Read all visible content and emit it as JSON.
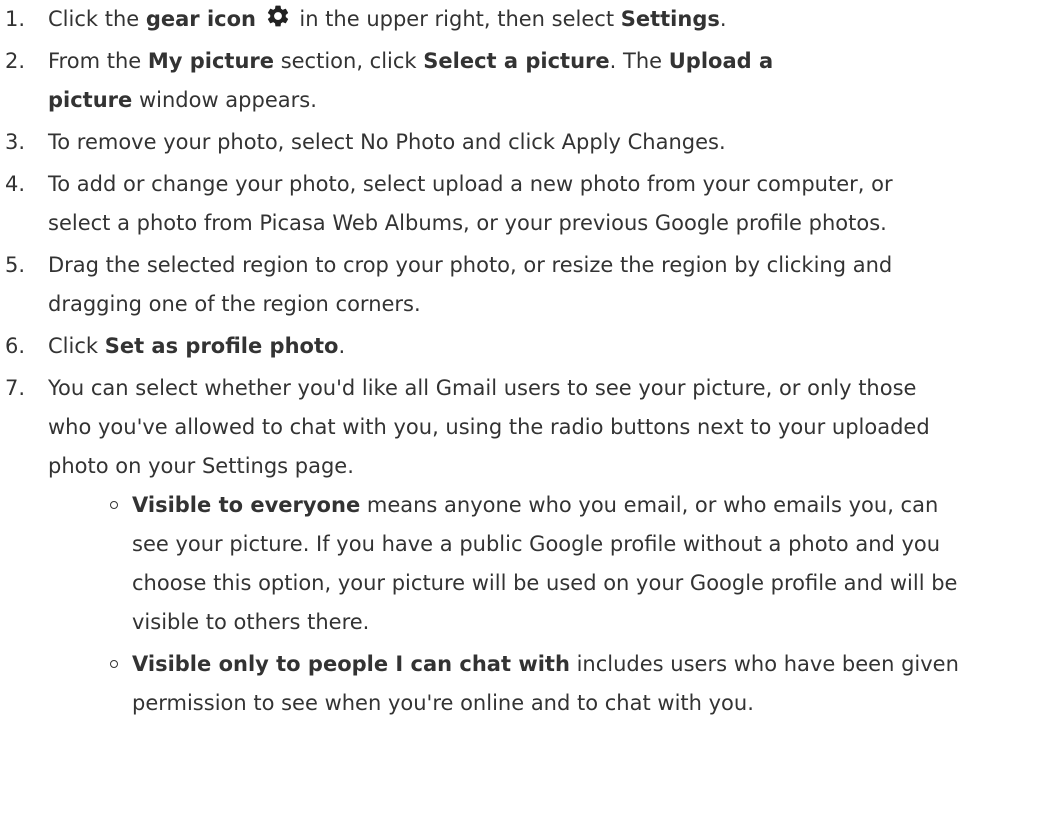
{
  "steps": [
    {
      "num": "1.",
      "parts": [
        "Click the ",
        "gear icon",
        " in the upper right, then select ",
        "Settings",
        "."
      ]
    },
    {
      "num": "2.",
      "parts": [
        "From the ",
        "My picture",
        " section, click ",
        "Select a picture",
        ". The ",
        "Upload a",
        "picture",
        " window appears."
      ]
    },
    {
      "num": "3.",
      "line1": "To remove your photo, select No Photo and click Apply Changes."
    },
    {
      "num": "4.",
      "line1": "To add or change your photo, select upload a new photo from your computer, or",
      "line2": "select a photo from Picasa Web Albums, or your previous Google profile photos."
    },
    {
      "num": "5.",
      "line1": "Drag the selected region to crop your photo, or resize the region by clicking and",
      "line2": "dragging one of the region corners."
    },
    {
      "num": "6.",
      "parts": [
        "Click ",
        "Set as profile photo",
        "."
      ]
    },
    {
      "num": "7.",
      "line1": "You can select whether you'd like all Gmail users to see your picture, or only those",
      "line2": "who you've allowed to chat with you, using the radio buttons next to your uploaded",
      "line3": "photo on your Settings page."
    }
  ],
  "options": [
    {
      "bold": "Visible to everyone",
      "line1": " means anyone who you email, or who emails you, can",
      "line2": "see your picture. If you have a public Google profile without a photo and you",
      "line3": "choose this option, your picture will be used on your Google profile and will be",
      "line4": "visible to others there."
    },
    {
      "bold": "Visible only to people I can chat with",
      "line1": " includes users who have been given",
      "line2": "permission to see when you're online and to chat with you."
    }
  ]
}
